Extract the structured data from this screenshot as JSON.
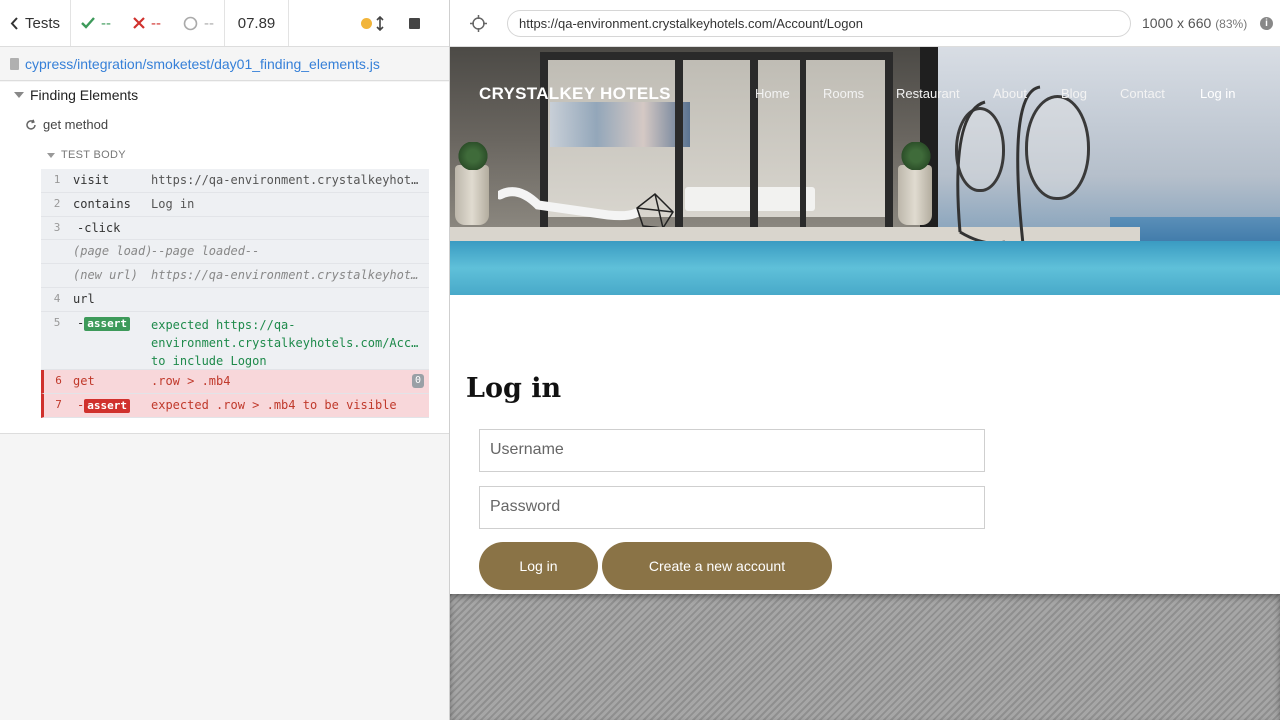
{
  "runner": {
    "tests_label": "Tests",
    "passed": "--",
    "failed": "--",
    "pending": "--",
    "duration": "07.89",
    "spec_path": "cypress/integration/smoketest/day01_finding_elements.js",
    "suite_title": "Finding Elements",
    "test_title": "get method",
    "test_body_label": "TEST BODY",
    "commands": [
      {
        "num": "1",
        "name": "visit",
        "message": "https://qa-environment.crystalkeyhotels.com/Account/Logon"
      },
      {
        "num": "2",
        "name": "contains",
        "message": "Log in"
      },
      {
        "num": "3",
        "name": "-click",
        "message": ""
      },
      {
        "num": "",
        "name": "(page load)",
        "message": "--page loaded--"
      },
      {
        "num": "",
        "name": "(new url)",
        "message": "https://qa-environment.crystalkeyhotels.com/Account/Logon"
      },
      {
        "num": "4",
        "name": "url",
        "message": ""
      },
      {
        "num": "5",
        "name": "-",
        "badge": "assert",
        "message": "expected https://qa-environment.crystalkeyhotels.com/Account/Logon to include Logon"
      },
      {
        "num": "6",
        "name": "get",
        "message": ".row > .mb4",
        "count": "0"
      },
      {
        "num": "7",
        "name": "-",
        "badge": "assert",
        "message": "expected .row > .mb4 to be visible"
      }
    ]
  },
  "aut": {
    "url": "https://qa-environment.crystalkeyhotels.com/Account/Logon",
    "viewport": "1000 x 660",
    "scale": "(83%)"
  },
  "site": {
    "logo": "CRYSTALKEY HOTELS",
    "nav": [
      "Home",
      "Rooms",
      "Restaurant",
      "About",
      "Blog",
      "Contact",
      "Log in"
    ],
    "login_title": "Log in",
    "username_placeholder": "Username",
    "password_placeholder": "Password",
    "login_button": "Log in",
    "create_account_button": "Create a new account"
  },
  "colors": {
    "pass": "#3d9a5a",
    "fail": "#d0312d",
    "link": "#3680d8",
    "button": "#8a7346"
  }
}
